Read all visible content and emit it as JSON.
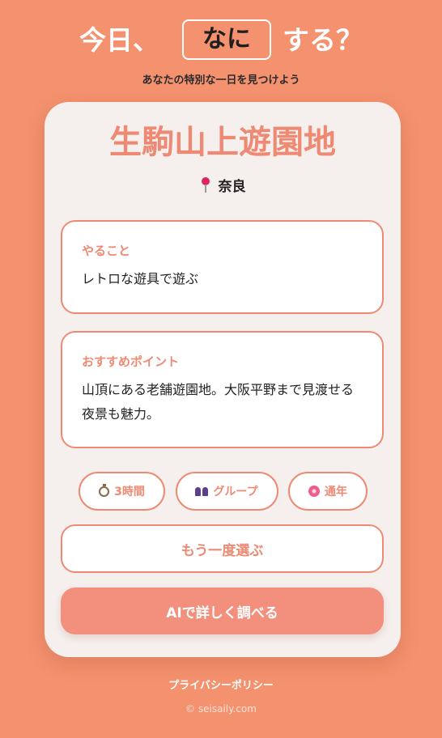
{
  "header": {
    "title_pre": "今日、",
    "title_choice": "なに",
    "title_post": "する？",
    "subtitle": "あなたの特別な一日を見つけよう"
  },
  "spot": {
    "name": "生駒山上遊園地",
    "location": "奈良",
    "location_icon": "pin-icon"
  },
  "todo": {
    "label": "やること",
    "text": "レトロな遊具で遊ぶ"
  },
  "recommend": {
    "label": "おすすめポイント",
    "text": "山頂にある老舗遊園地。大阪平野まで見渡せる夜景も魅力。"
  },
  "tags": [
    {
      "icon": "timer-icon",
      "label": "3時間"
    },
    {
      "icon": "group-icon",
      "label": "グループ"
    },
    {
      "icon": "blossom-icon",
      "label": "通年"
    }
  ],
  "buttons": {
    "reselect": "もう一度選ぶ",
    "ai": "AIで詳しく調べる"
  },
  "footer": {
    "privacy": "プライバシーポリシー",
    "copyright": "© seisaily.com"
  },
  "colors": {
    "background": "#F4916E",
    "accent": "#EE8A73",
    "card": "#F5F0EE"
  }
}
